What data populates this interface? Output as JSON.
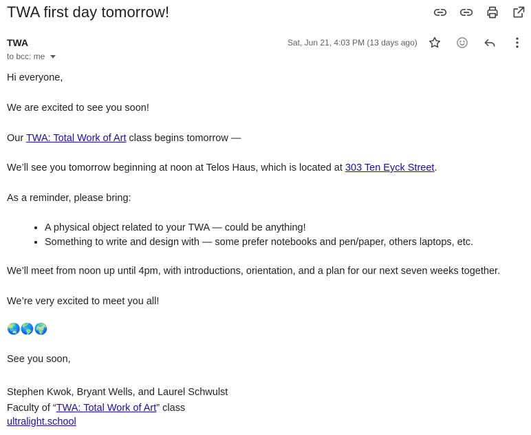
{
  "email": {
    "subject": "TWA first day tomorrow!",
    "sender": "TWA",
    "to_label": "to bcc: me",
    "date": "Sat, Jun 21, 4:03 PM (13 days ago)"
  },
  "body": {
    "greeting": "Hi everyone,",
    "excited": "We are excited to see you soon!",
    "class_prefix": "Our ",
    "class_link": "TWA: Total Work of Art",
    "class_suffix": " class begins tomorrow —",
    "location_prefix": "We’ll see you tomorrow beginning at noon at Telos Haus, which is located at ",
    "location_link": "303 Ten Eyck Street",
    "location_suffix": ".",
    "reminder": "As a reminder, please bring:",
    "bring_items": [
      "A physical object related to your TWA — could be anything!",
      "Something to write and design with — some prefer notebooks and pen/paper, others laptops, etc."
    ],
    "meet": "We’ll meet from noon up until 4pm, with introductions, orientation, and a plan for our next seven weeks together.",
    "excited_meet": "We’re very excited to meet you all!",
    "globes": "🌏🌎🌍",
    "see_you": "See you soon,",
    "signature_names": "Stephen Kwok, Bryant Wells, and Laurel Schwulst",
    "faculty_prefix": "Faculty of “",
    "faculty_link": "TWA: Total Work of Art",
    "faculty_suffix": "” class",
    "site_link": "ultralight.school"
  },
  "icons": {
    "top": [
      "link-icon",
      "link-icon",
      "print-icon",
      "open-in-new-window-icon"
    ],
    "message": [
      "star-icon",
      "emoji-icon",
      "reply-icon",
      "more-options-icon"
    ]
  },
  "colors": {
    "link": "#1a0dab",
    "text": "#222222"
  }
}
